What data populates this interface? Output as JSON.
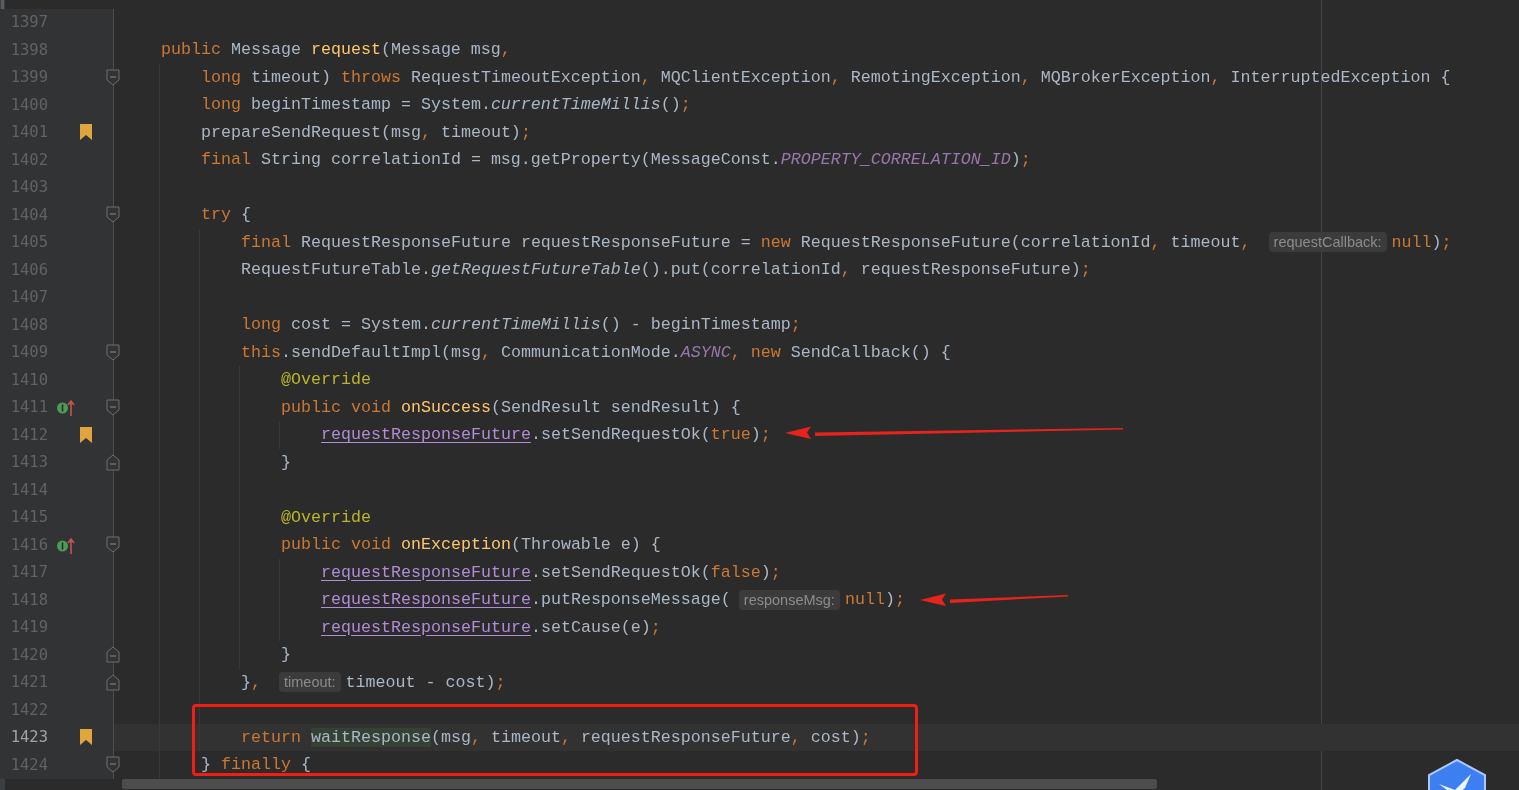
{
  "editor": {
    "lines": [
      {
        "number": "1397",
        "bookmarked": false,
        "implements": false,
        "current": false
      },
      {
        "number": "1398",
        "bookmarked": false,
        "implements": false,
        "current": false,
        "tokens": [
          {
            "text": "public ",
            "kind": "kw"
          },
          {
            "text": "Message ",
            "kind": "plain"
          },
          {
            "text": "request",
            "kind": "fn"
          },
          {
            "text": "(Message msg",
            "kind": "plain"
          },
          {
            "text": ",",
            "kind": "punct"
          }
        ],
        "children": [
          {
            "number": "1399",
            "kind": "fold_start",
            "bookmarked": false,
            "implements": false,
            "current": false,
            "tokens": [
              {
                "text": "long ",
                "kind": "kw"
              },
              {
                "text": "timeout) ",
                "kind": "plain"
              },
              {
                "text": "throws ",
                "kind": "kw"
              },
              {
                "text": "RequestTimeoutException",
                "kind": "plain"
              },
              {
                "text": ", ",
                "kind": "punct"
              },
              {
                "text": "MQClientException",
                "kind": "plain"
              },
              {
                "text": ", ",
                "kind": "punct"
              },
              {
                "text": "RemotingException",
                "kind": "plain"
              },
              {
                "text": ", ",
                "kind": "punct"
              },
              {
                "text": "MQBrokerException",
                "kind": "plain"
              },
              {
                "text": ", ",
                "kind": "punct"
              },
              {
                "text": "InterruptedException {",
                "kind": "plain"
              }
            ]
          },
          {
            "number": "1400",
            "bookmarked": false,
            "implements": false,
            "current": false,
            "tokens": [
              {
                "text": "long ",
                "kind": "kw"
              },
              {
                "text": "beginTimestamp = System.",
                "kind": "plain"
              },
              {
                "text": "currentTimeMillis",
                "kind": "static"
              },
              {
                "text": "()",
                "kind": "plain"
              },
              {
                "text": ";",
                "kind": "punct"
              }
            ]
          },
          {
            "number": "1401",
            "bookmarked": true,
            "implements": false,
            "current": false,
            "tokens": [
              {
                "text": "prepareSendRequest(msg",
                "kind": "plain"
              },
              {
                "text": ", ",
                "kind": "punct"
              },
              {
                "text": "timeout)",
                "kind": "plain"
              },
              {
                "text": ";",
                "kind": "punct"
              }
            ]
          },
          {
            "number": "1402",
            "bookmarked": false,
            "implements": false,
            "current": false,
            "tokens": [
              {
                "text": "final ",
                "kind": "kw"
              },
              {
                "text": "String correlationId = msg.getProperty(MessageConst.",
                "kind": "plain"
              },
              {
                "text": "PROPERTY_CORRELATION_ID",
                "kind": "const"
              },
              {
                "text": ")",
                "kind": "plain"
              },
              {
                "text": ";",
                "kind": "punct"
              }
            ]
          },
          {
            "number": "1403",
            "bookmarked": false,
            "implements": false,
            "current": false
          },
          {
            "number": "1404",
            "kind": "fold_start",
            "bookmarked": false,
            "implements": false,
            "current": false,
            "tokens": [
              {
                "text": "try ",
                "kind": "kw"
              },
              {
                "text": "{",
                "kind": "plain"
              }
            ],
            "children": [
              {
                "number": "1405",
                "bookmarked": false,
                "implements": false,
                "current": false,
                "tokens": [
                  {
                    "text": "final ",
                    "kind": "kw"
                  },
                  {
                    "text": "RequestResponseFuture requestResponseFuture = ",
                    "kind": "plain"
                  },
                  {
                    "text": "new ",
                    "kind": "kw"
                  },
                  {
                    "text": "RequestResponseFuture(correlationId",
                    "kind": "plain"
                  },
                  {
                    "text": ", ",
                    "kind": "punct"
                  },
                  {
                    "text": "timeout",
                    "kind": "plain"
                  },
                  {
                    "text": ", ",
                    "kind": "punct"
                  },
                  {
                    "text": "requestCallback:",
                    "kind": "hint"
                  },
                  {
                    "text": "null",
                    "kind": "kw"
                  },
                  {
                    "text": ")",
                    "kind": "plain"
                  },
                  {
                    "text": ";",
                    "kind": "punct"
                  }
                ]
              },
              {
                "number": "1406",
                "bookmarked": false,
                "implements": false,
                "current": false,
                "tokens": [
                  {
                    "text": "RequestFutureTable.",
                    "kind": "plain"
                  },
                  {
                    "text": "getRequestFutureTable",
                    "kind": "static"
                  },
                  {
                    "text": "().put(correlationId",
                    "kind": "plain"
                  },
                  {
                    "text": ", ",
                    "kind": "punct"
                  },
                  {
                    "text": "requestResponseFuture)",
                    "kind": "plain"
                  },
                  {
                    "text": ";",
                    "kind": "punct"
                  }
                ]
              },
              {
                "number": "1407",
                "bookmarked": false,
                "implements": false,
                "current": false
              },
              {
                "number": "1408",
                "bookmarked": false,
                "implements": false,
                "current": false,
                "tokens": [
                  {
                    "text": "long ",
                    "kind": "kw"
                  },
                  {
                    "text": "cost = System.",
                    "kind": "plain"
                  },
                  {
                    "text": "currentTimeMillis",
                    "kind": "static"
                  },
                  {
                    "text": "() - beginTimestamp",
                    "kind": "plain"
                  },
                  {
                    "text": ";",
                    "kind": "punct"
                  }
                ]
              },
              {
                "number": "1409",
                "kind": "fold_start",
                "bookmarked": false,
                "implements": false,
                "current": false,
                "tokens": [
                  {
                    "text": "this",
                    "kind": "kw"
                  },
                  {
                    "text": ".sendDefaultImpl(msg",
                    "kind": "plain"
                  },
                  {
                    "text": ", ",
                    "kind": "punct"
                  },
                  {
                    "text": "CommunicationMode.",
                    "kind": "plain"
                  },
                  {
                    "text": "ASYNC",
                    "kind": "const"
                  },
                  {
                    "text": ", ",
                    "kind": "punct"
                  },
                  {
                    "text": "new ",
                    "kind": "kw"
                  },
                  {
                    "text": "SendCallback() {",
                    "kind": "plain"
                  }
                ],
                "children": [
                  {
                    "number": "1410",
                    "bookmarked": false,
                    "implements": false,
                    "current": false,
                    "tokens": [
                      {
                        "text": "@Override",
                        "kind": "ann"
                      }
                    ]
                  },
                  {
                    "number": "1411",
                    "kind": "fold_start",
                    "bookmarked": false,
                    "implements": true,
                    "current": false,
                    "tokens": [
                      {
                        "text": "public void ",
                        "kind": "kw"
                      },
                      {
                        "text": "onSuccess",
                        "kind": "fn"
                      },
                      {
                        "text": "(SendResult sendResult) {",
                        "kind": "plain"
                      }
                    ],
                    "children": [
                      {
                        "number": "1412",
                        "bookmarked": true,
                        "implements": false,
                        "current": false,
                        "tokens": [
                          {
                            "text": "requestResponseFuture",
                            "kind": "captured"
                          },
                          {
                            "text": ".setSendRequestOk(",
                            "kind": "plain"
                          },
                          {
                            "text": "true",
                            "kind": "kw"
                          },
                          {
                            "text": ")",
                            "kind": "plain"
                          },
                          {
                            "text": ";",
                            "kind": "punct"
                          }
                        ]
                      }
                    ]
                  },
                  {
                    "number": "1413",
                    "kind": "fold_end",
                    "bookmarked": false,
                    "implements": false,
                    "current": false,
                    "tokens": [
                      {
                        "text": "}",
                        "kind": "plain"
                      }
                    ]
                  },
                  {
                    "number": "1414",
                    "bookmarked": false,
                    "implements": false,
                    "current": false
                  },
                  {
                    "number": "1415",
                    "bookmarked": false,
                    "implements": false,
                    "current": false,
                    "tokens": [
                      {
                        "text": "@Override",
                        "kind": "ann"
                      }
                    ]
                  },
                  {
                    "number": "1416",
                    "kind": "fold_start",
                    "bookmarked": false,
                    "implements": true,
                    "current": false,
                    "tokens": [
                      {
                        "text": "public void ",
                        "kind": "kw"
                      },
                      {
                        "text": "onException",
                        "kind": "fn"
                      },
                      {
                        "text": "(Throwable e) {",
                        "kind": "plain"
                      }
                    ],
                    "children": [
                      {
                        "number": "1417",
                        "bookmarked": false,
                        "implements": false,
                        "current": false,
                        "tokens": [
                          {
                            "text": "requestResponseFuture",
                            "kind": "captured"
                          },
                          {
                            "text": ".setSendRequestOk(",
                            "kind": "plain"
                          },
                          {
                            "text": "false",
                            "kind": "kw"
                          },
                          {
                            "text": ")",
                            "kind": "plain"
                          },
                          {
                            "text": ";",
                            "kind": "punct"
                          }
                        ]
                      },
                      {
                        "number": "1418",
                        "bookmarked": false,
                        "implements": false,
                        "current": false,
                        "tokens": [
                          {
                            "text": "requestResponseFuture",
                            "kind": "captured"
                          },
                          {
                            "text": ".putResponseMessage(",
                            "kind": "plain"
                          },
                          {
                            "text": "responseMsg:",
                            "kind": "hint"
                          },
                          {
                            "text": "null",
                            "kind": "kw"
                          },
                          {
                            "text": ")",
                            "kind": "plain"
                          },
                          {
                            "text": ";",
                            "kind": "punct"
                          }
                        ]
                      },
                      {
                        "number": "1419",
                        "bookmarked": false,
                        "implements": false,
                        "current": false,
                        "tokens": [
                          {
                            "text": "requestResponseFuture",
                            "kind": "captured"
                          },
                          {
                            "text": ".setCause(e)",
                            "kind": "plain"
                          },
                          {
                            "text": ";",
                            "kind": "punct"
                          }
                        ]
                      }
                    ]
                  },
                  {
                    "number": "1420",
                    "kind": "fold_end",
                    "bookmarked": false,
                    "implements": false,
                    "current": false,
                    "tokens": [
                      {
                        "text": "}",
                        "kind": "plain"
                      }
                    ]
                  }
                ]
              },
              {
                "number": "1421",
                "kind": "fold_end",
                "bookmarked": false,
                "implements": false,
                "current": false,
                "tokens": [
                  {
                    "text": "}",
                    "kind": "plain"
                  },
                  {
                    "text": ", ",
                    "kind": "punct"
                  },
                  {
                    "text": "timeout:",
                    "kind": "hint"
                  },
                  {
                    "text": "timeout - cost)",
                    "kind": "plain"
                  },
                  {
                    "text": ";",
                    "kind": "punct"
                  }
                ]
              },
              {
                "number": "1422",
                "bookmarked": false,
                "implements": false,
                "current": false
              },
              {
                "number": "1423",
                "bookmarked": true,
                "implements": false,
                "current": true,
                "tokens": [
                  {
                    "text": "return ",
                    "kind": "kw"
                  },
                  {
                    "text": "waitResponse",
                    "kind": "match"
                  },
                  {
                    "text": "(msg",
                    "kind": "plain"
                  },
                  {
                    "text": ", ",
                    "kind": "punct"
                  },
                  {
                    "text": "timeout",
                    "kind": "plain"
                  },
                  {
                    "text": ", ",
                    "kind": "punct"
                  },
                  {
                    "text": "requestResponseFuture",
                    "kind": "plain"
                  },
                  {
                    "text": ", ",
                    "kind": "punct"
                  },
                  {
                    "text": "cost)",
                    "kind": "plain"
                  },
                  {
                    "text": ";",
                    "kind": "punct"
                  }
                ]
              }
            ]
          },
          {
            "number": "1424",
            "kind": "fold_start",
            "bookmarked": false,
            "implements": false,
            "current": false,
            "tokens": [
              {
                "text": "} ",
                "kind": "plain"
              },
              {
                "text": "finally ",
                "kind": "kw"
              },
              {
                "text": "{",
                "kind": "plain"
              }
            ]
          }
        ]
      }
    ]
  },
  "annotations": [
    {
      "kind": "arrow"
    },
    {
      "kind": "arrow"
    },
    {
      "kind": "box"
    }
  ]
}
